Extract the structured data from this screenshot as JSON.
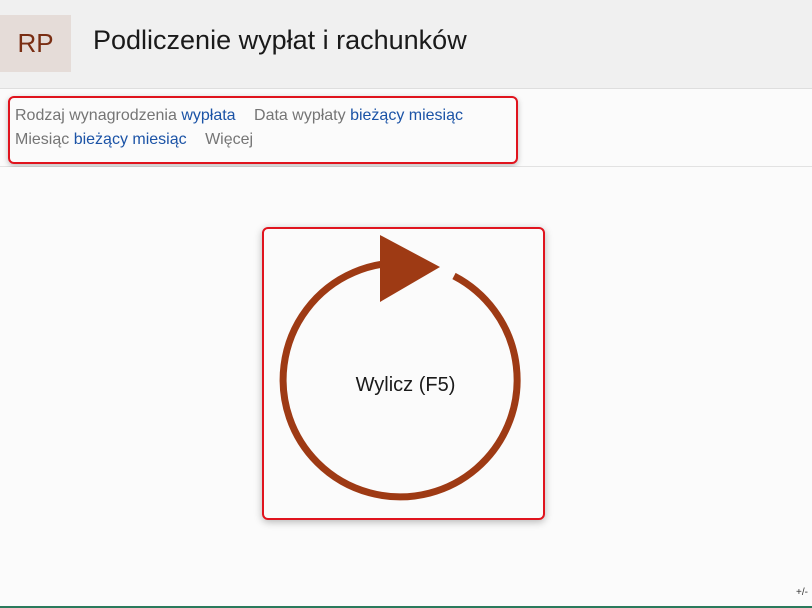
{
  "header": {
    "badge": "RP",
    "title": "Podliczenie wypłat i rachunków"
  },
  "filters": [
    {
      "label": "Rodzaj wynagrodzenia",
      "value": "wypłata"
    },
    {
      "label": "Data wypłaty",
      "value": "bieżący miesiąc"
    },
    {
      "label": "Miesiąc",
      "value": "bieżący miesiąc"
    }
  ],
  "more_label": "Więcej",
  "compute": {
    "label": "Wylicz (F5)",
    "icon": "refresh-cycle-icon",
    "color": "#9e3a14"
  },
  "toggle_label": "+/-",
  "colors": {
    "accent": "#9e3a14",
    "link": "#1b53a6",
    "highlight": "#e0141e"
  }
}
